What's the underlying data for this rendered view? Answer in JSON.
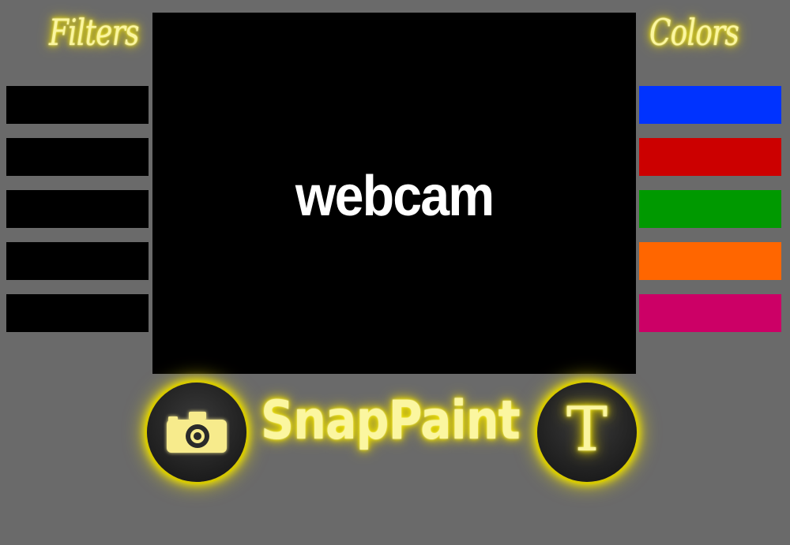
{
  "filters": {
    "title": "Filters",
    "swatches": [
      "#000000",
      "#000000",
      "#000000",
      "#000000",
      "#000000"
    ]
  },
  "colors": {
    "title": "Colors",
    "swatches": [
      "#0033ff",
      "#cc0000",
      "#009900",
      "#ff6600",
      "#cc0066"
    ]
  },
  "webcam": {
    "label": "webcam"
  },
  "app": {
    "title": "SnapPaint"
  },
  "buttons": {
    "camera_icon": "camera-icon",
    "text_tool_glyph": "T",
    "text_tool_icon": "text-tool-icon"
  },
  "theme": {
    "background": "#6a6a6a",
    "glow": "#f2e600"
  }
}
